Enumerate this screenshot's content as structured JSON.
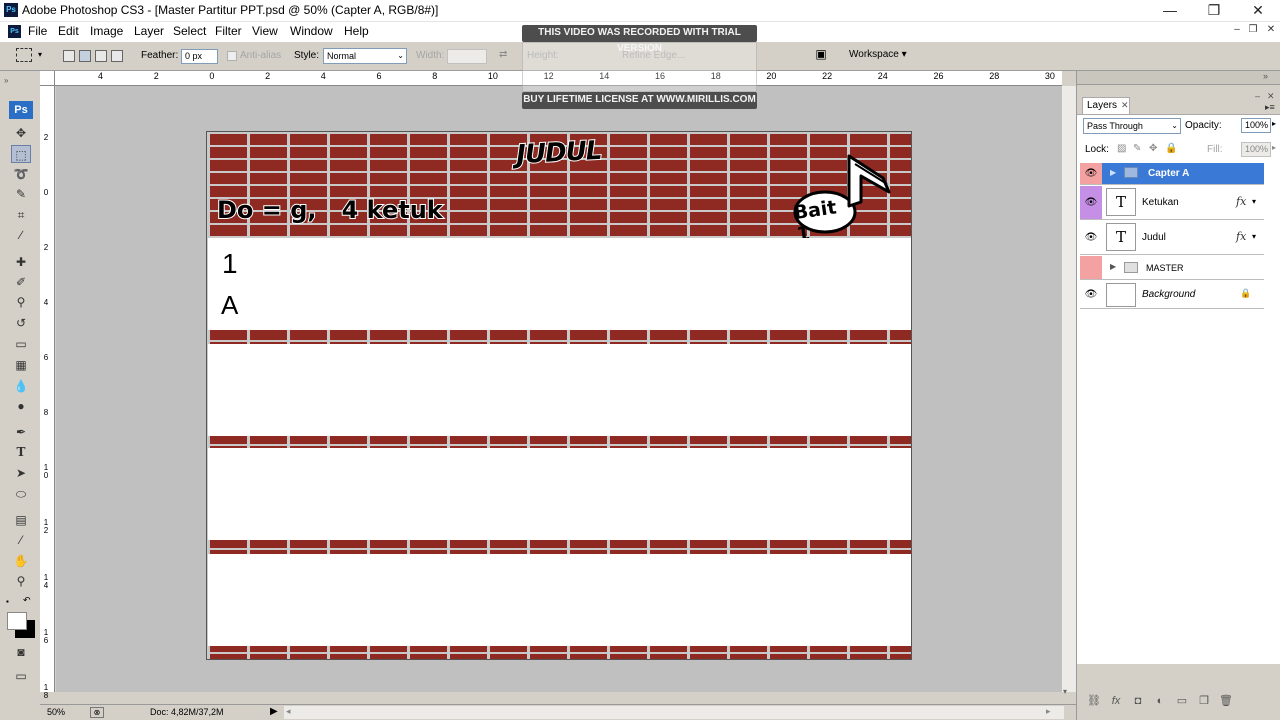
{
  "window": {
    "title": "Adobe Photoshop CS3 - [Master Partitur PPT.psd @ 50% (Capter A, RGB/8#)]",
    "minimize": "—",
    "restore": "❐",
    "close": "✕"
  },
  "menu": [
    "File",
    "Edit",
    "Image",
    "Layer",
    "Select",
    "Filter",
    "View",
    "Window",
    "Help"
  ],
  "options": {
    "feather_label": "Feather:",
    "feather_value": "0 px",
    "antialias_label": "Anti-alias",
    "style_label": "Style:",
    "style_value": "Normal",
    "width_label": "Width:",
    "height_label": "Height:",
    "refine_label": "Refine Edge...",
    "workspace_label": "Workspace ▾"
  },
  "watermark": {
    "top": "THIS VIDEO WAS RECORDED WITH TRIAL VERSION",
    "bottom": "BUY LIFETIME LICENSE AT WWW.MIRILLIS.COM"
  },
  "ruler_top": [
    "4",
    "2",
    "0",
    "2",
    "4",
    "6",
    "8",
    "10",
    "12",
    "14",
    "16",
    "18",
    "20",
    "22",
    "24",
    "26",
    "28",
    "30"
  ],
  "ruler_left": [
    "2",
    "0",
    "2",
    "4",
    "6",
    "8",
    "1 0",
    "1 2",
    "1 4",
    "1 6",
    "1 8"
  ],
  "document": {
    "title_text": "JUDUL",
    "key_text": "Do = g,   4 ketuk",
    "verse_text": "Bait 1",
    "row1_number": "1",
    "row1_letter": "A"
  },
  "status": {
    "zoom": "50%",
    "doc_info": "Doc: 4,82M/37,2M"
  },
  "layers_panel": {
    "tab_label": "Layers",
    "blend_mode": "Pass Through",
    "opacity_label": "Opacity:",
    "opacity_value": "100%",
    "lock_label": "Lock:",
    "fill_label": "Fill:",
    "fill_value": "100%",
    "layers": [
      {
        "name": "Capter A",
        "type": "group",
        "selected": true
      },
      {
        "name": "Ketukan",
        "type": "text",
        "fx": "fx"
      },
      {
        "name": "Judul",
        "type": "text",
        "fx": "fx"
      },
      {
        "name": "MASTER",
        "type": "group"
      },
      {
        "name": "Background",
        "type": "image"
      }
    ]
  },
  "colors": {
    "selection": "#3a7ad6",
    "brick": "#8e2a22",
    "eye_pink": "#f3a1a1",
    "eye_purple": "#c58fe6"
  }
}
